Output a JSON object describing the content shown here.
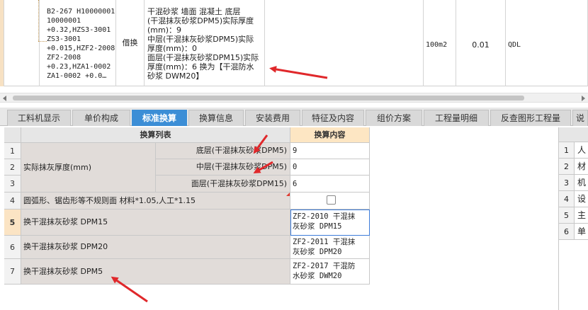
{
  "item_row": {
    "code_lines": [
      "B2-267 H10000001",
      "10000001",
      "+0.32,HZS3-3001",
      "ZS3-3001",
      "+0.015,HZF2-2008",
      "ZF2-2008",
      "+0.23,HZA1-0002",
      "ZA1-0002 +0.0…"
    ],
    "type": "借换",
    "name_lines": [
      "干混砂浆 墙面 混凝土  底层",
      "(干混抹灰砂浆DPM5)实际厚度",
      "(mm)：9",
      "中层(干混抹灰砂浆DPM5)实际",
      "厚度(mm)：0",
      "面层(干混抹灰砂浆DPM15)实际",
      "厚度(mm)：6  换为【干混防水",
      "砂浆 DWM20】"
    ],
    "unit": "100m2",
    "quantity": "0.01",
    "expression": "QDL"
  },
  "tabs": [
    {
      "label": "工料机显示",
      "active": false
    },
    {
      "label": "单价构成",
      "active": false
    },
    {
      "label": "标准换算",
      "active": true
    },
    {
      "label": "换算信息",
      "active": false
    },
    {
      "label": "安装费用",
      "active": false
    },
    {
      "label": "特征及内容",
      "active": false
    },
    {
      "label": "组价方案",
      "active": false
    },
    {
      "label": "工程量明细",
      "active": false
    },
    {
      "label": "反查图形工程量",
      "active": false
    },
    {
      "label": "说",
      "active": false
    }
  ],
  "conversion": {
    "header_list": "换算列表",
    "header_content": "换算内容",
    "group_label": "实际抹灰厚度(mm)",
    "rows": [
      {
        "num": "1",
        "label": "底层(干混抹灰砂浆DPM5)",
        "value": "9"
      },
      {
        "num": "2",
        "label": "中层(干混抹灰砂浆DPM5)",
        "value": "0"
      },
      {
        "num": "3",
        "label": "面层(干混抹灰砂浆DPM15)",
        "value": "6"
      },
      {
        "num": "4",
        "label": "圆弧形、锯齿形等不规则面 材料*1.05,人工*1.15",
        "checked": false
      },
      {
        "num": "5",
        "label": "换干混抹灰砂浆 DPM15",
        "value_lines": [
          "ZF2-2010  干混抹",
          "灰砂浆 DPM15"
        ]
      },
      {
        "num": "6",
        "label": "换干混抹灰砂浆 DPM20",
        "value_lines": [
          "ZF2-2011  干混抹",
          "灰砂浆 DPM20"
        ]
      },
      {
        "num": "7",
        "label": "换干混抹灰砂浆 DPM5",
        "value_lines": [
          "ZF2-2017  干混防",
          "水砂浆 DWM20"
        ]
      }
    ]
  },
  "side_panel": {
    "rows": [
      {
        "num": "1",
        "text": "人"
      },
      {
        "num": "2",
        "text": "材"
      },
      {
        "num": "3",
        "text": "机"
      },
      {
        "num": "4",
        "text": "设"
      },
      {
        "num": "5",
        "text": "主"
      },
      {
        "num": "6",
        "text": "单"
      }
    ]
  },
  "colors": {
    "active_tab": "#3c8ed6",
    "annotation_arrow": "#e0282b",
    "gray_cell": "#e1dcd9",
    "header_highlight": "#fde6c3"
  }
}
